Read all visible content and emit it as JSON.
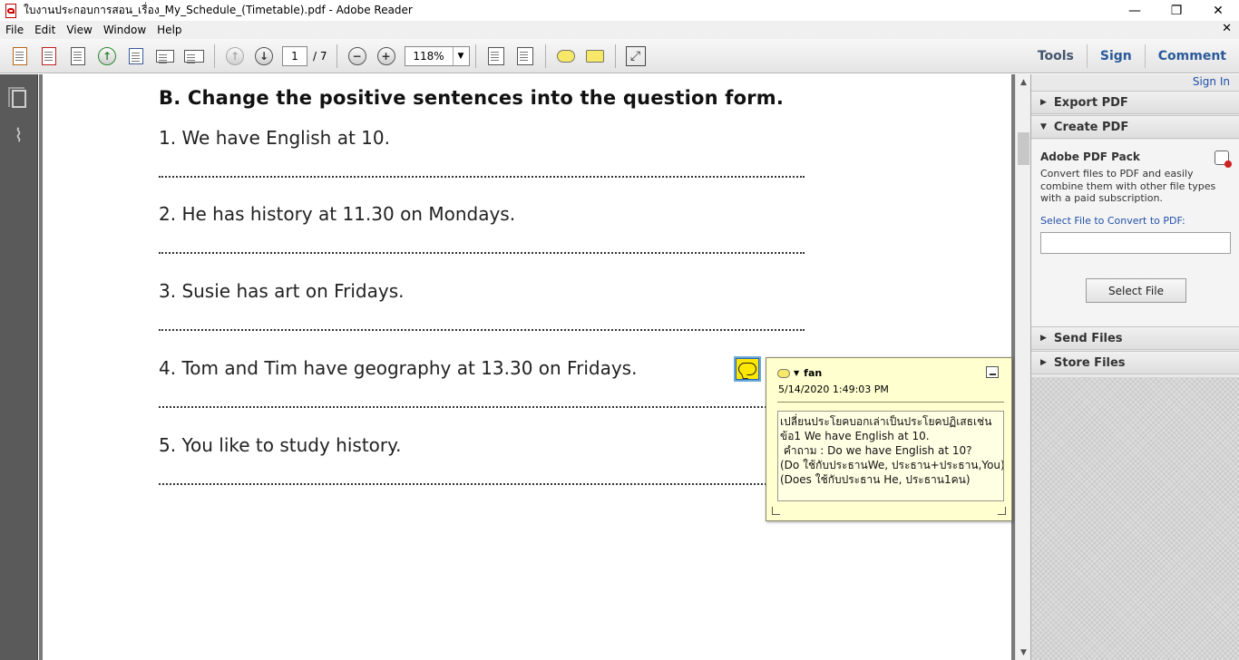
{
  "window": {
    "title": "ใบงานประกอบการสอน_เรื่อง_My_Schedule_(Timetable).pdf - Adobe Reader",
    "minimize": "—",
    "maximize": "❐",
    "close": "✕"
  },
  "menu": {
    "items": [
      "File",
      "Edit",
      "View",
      "Window",
      "Help"
    ],
    "close": "✕"
  },
  "toolbar": {
    "page_current": "1",
    "page_total": "/ 7",
    "zoom": "118%",
    "tools_label": "Tools",
    "sign_label": "Sign",
    "comment_label": "Comment"
  },
  "document": {
    "heading": "B. Change the positive sentences into the question form.",
    "sentences": [
      "1. We have English at 10.",
      "2. He has history at 11.30 on Mondays.",
      "3. Susie has art on Fridays.",
      "4. Tom and Tim have geography at 13.30 on Fridays.",
      "5. You like to study history."
    ]
  },
  "note": {
    "author": "fan",
    "date": "5/14/2020 1:49:03 PM",
    "text": "เปลี่ยนประโยคบอกเล่าเป็นประโยคปฏิเสธเช่น\nข้อ1 We have English at 10.\n คำถาม : Do we have English at 10?\n(Do ใช้กับประธานWe, ประธาน+ประธาน,You)\n(Does ใช้กับประธาน He, ประธาน1คน)"
  },
  "right_pane": {
    "sign_in": "Sign In",
    "export_pdf": "Export PDF",
    "create_pdf": "Create PDF",
    "pack_title": "Adobe PDF Pack",
    "pack_desc": "Convert files to PDF and easily combine them with other file types with a paid subscription.",
    "select_label": "Select File to Convert to PDF:",
    "select_button": "Select File",
    "send_files": "Send Files",
    "store_files": "Store Files"
  }
}
